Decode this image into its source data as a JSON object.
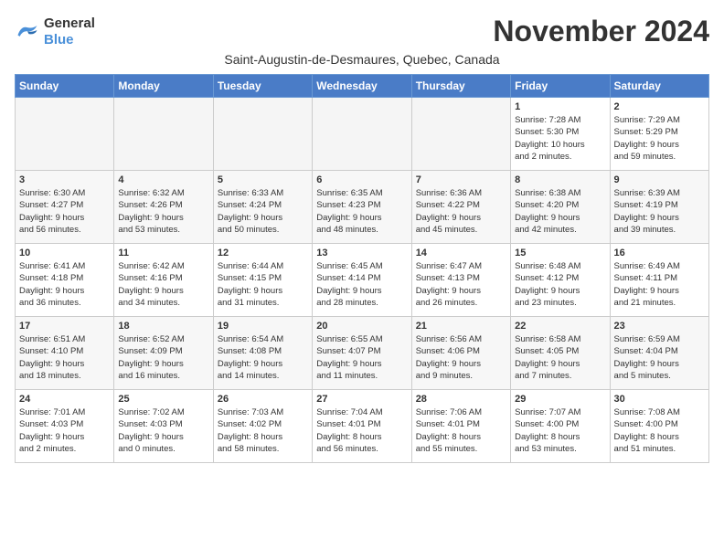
{
  "header": {
    "logo_general": "General",
    "logo_blue": "Blue",
    "month_year": "November 2024",
    "subtitle": "Saint-Augustin-de-Desmaures, Quebec, Canada"
  },
  "weekdays": [
    "Sunday",
    "Monday",
    "Tuesday",
    "Wednesday",
    "Thursday",
    "Friday",
    "Saturday"
  ],
  "weeks": [
    [
      {
        "day": "",
        "info": ""
      },
      {
        "day": "",
        "info": ""
      },
      {
        "day": "",
        "info": ""
      },
      {
        "day": "",
        "info": ""
      },
      {
        "day": "",
        "info": ""
      },
      {
        "day": "1",
        "info": "Sunrise: 7:28 AM\nSunset: 5:30 PM\nDaylight: 10 hours\nand 2 minutes."
      },
      {
        "day": "2",
        "info": "Sunrise: 7:29 AM\nSunset: 5:29 PM\nDaylight: 9 hours\nand 59 minutes."
      }
    ],
    [
      {
        "day": "3",
        "info": "Sunrise: 6:30 AM\nSunset: 4:27 PM\nDaylight: 9 hours\nand 56 minutes."
      },
      {
        "day": "4",
        "info": "Sunrise: 6:32 AM\nSunset: 4:26 PM\nDaylight: 9 hours\nand 53 minutes."
      },
      {
        "day": "5",
        "info": "Sunrise: 6:33 AM\nSunset: 4:24 PM\nDaylight: 9 hours\nand 50 minutes."
      },
      {
        "day": "6",
        "info": "Sunrise: 6:35 AM\nSunset: 4:23 PM\nDaylight: 9 hours\nand 48 minutes."
      },
      {
        "day": "7",
        "info": "Sunrise: 6:36 AM\nSunset: 4:22 PM\nDaylight: 9 hours\nand 45 minutes."
      },
      {
        "day": "8",
        "info": "Sunrise: 6:38 AM\nSunset: 4:20 PM\nDaylight: 9 hours\nand 42 minutes."
      },
      {
        "day": "9",
        "info": "Sunrise: 6:39 AM\nSunset: 4:19 PM\nDaylight: 9 hours\nand 39 minutes."
      }
    ],
    [
      {
        "day": "10",
        "info": "Sunrise: 6:41 AM\nSunset: 4:18 PM\nDaylight: 9 hours\nand 36 minutes."
      },
      {
        "day": "11",
        "info": "Sunrise: 6:42 AM\nSunset: 4:16 PM\nDaylight: 9 hours\nand 34 minutes."
      },
      {
        "day": "12",
        "info": "Sunrise: 6:44 AM\nSunset: 4:15 PM\nDaylight: 9 hours\nand 31 minutes."
      },
      {
        "day": "13",
        "info": "Sunrise: 6:45 AM\nSunset: 4:14 PM\nDaylight: 9 hours\nand 28 minutes."
      },
      {
        "day": "14",
        "info": "Sunrise: 6:47 AM\nSunset: 4:13 PM\nDaylight: 9 hours\nand 26 minutes."
      },
      {
        "day": "15",
        "info": "Sunrise: 6:48 AM\nSunset: 4:12 PM\nDaylight: 9 hours\nand 23 minutes."
      },
      {
        "day": "16",
        "info": "Sunrise: 6:49 AM\nSunset: 4:11 PM\nDaylight: 9 hours\nand 21 minutes."
      }
    ],
    [
      {
        "day": "17",
        "info": "Sunrise: 6:51 AM\nSunset: 4:10 PM\nDaylight: 9 hours\nand 18 minutes."
      },
      {
        "day": "18",
        "info": "Sunrise: 6:52 AM\nSunset: 4:09 PM\nDaylight: 9 hours\nand 16 minutes."
      },
      {
        "day": "19",
        "info": "Sunrise: 6:54 AM\nSunset: 4:08 PM\nDaylight: 9 hours\nand 14 minutes."
      },
      {
        "day": "20",
        "info": "Sunrise: 6:55 AM\nSunset: 4:07 PM\nDaylight: 9 hours\nand 11 minutes."
      },
      {
        "day": "21",
        "info": "Sunrise: 6:56 AM\nSunset: 4:06 PM\nDaylight: 9 hours\nand 9 minutes."
      },
      {
        "day": "22",
        "info": "Sunrise: 6:58 AM\nSunset: 4:05 PM\nDaylight: 9 hours\nand 7 minutes."
      },
      {
        "day": "23",
        "info": "Sunrise: 6:59 AM\nSunset: 4:04 PM\nDaylight: 9 hours\nand 5 minutes."
      }
    ],
    [
      {
        "day": "24",
        "info": "Sunrise: 7:01 AM\nSunset: 4:03 PM\nDaylight: 9 hours\nand 2 minutes."
      },
      {
        "day": "25",
        "info": "Sunrise: 7:02 AM\nSunset: 4:03 PM\nDaylight: 9 hours\nand 0 minutes."
      },
      {
        "day": "26",
        "info": "Sunrise: 7:03 AM\nSunset: 4:02 PM\nDaylight: 8 hours\nand 58 minutes."
      },
      {
        "day": "27",
        "info": "Sunrise: 7:04 AM\nSunset: 4:01 PM\nDaylight: 8 hours\nand 56 minutes."
      },
      {
        "day": "28",
        "info": "Sunrise: 7:06 AM\nSunset: 4:01 PM\nDaylight: 8 hours\nand 55 minutes."
      },
      {
        "day": "29",
        "info": "Sunrise: 7:07 AM\nSunset: 4:00 PM\nDaylight: 8 hours\nand 53 minutes."
      },
      {
        "day": "30",
        "info": "Sunrise: 7:08 AM\nSunset: 4:00 PM\nDaylight: 8 hours\nand 51 minutes."
      }
    ]
  ]
}
